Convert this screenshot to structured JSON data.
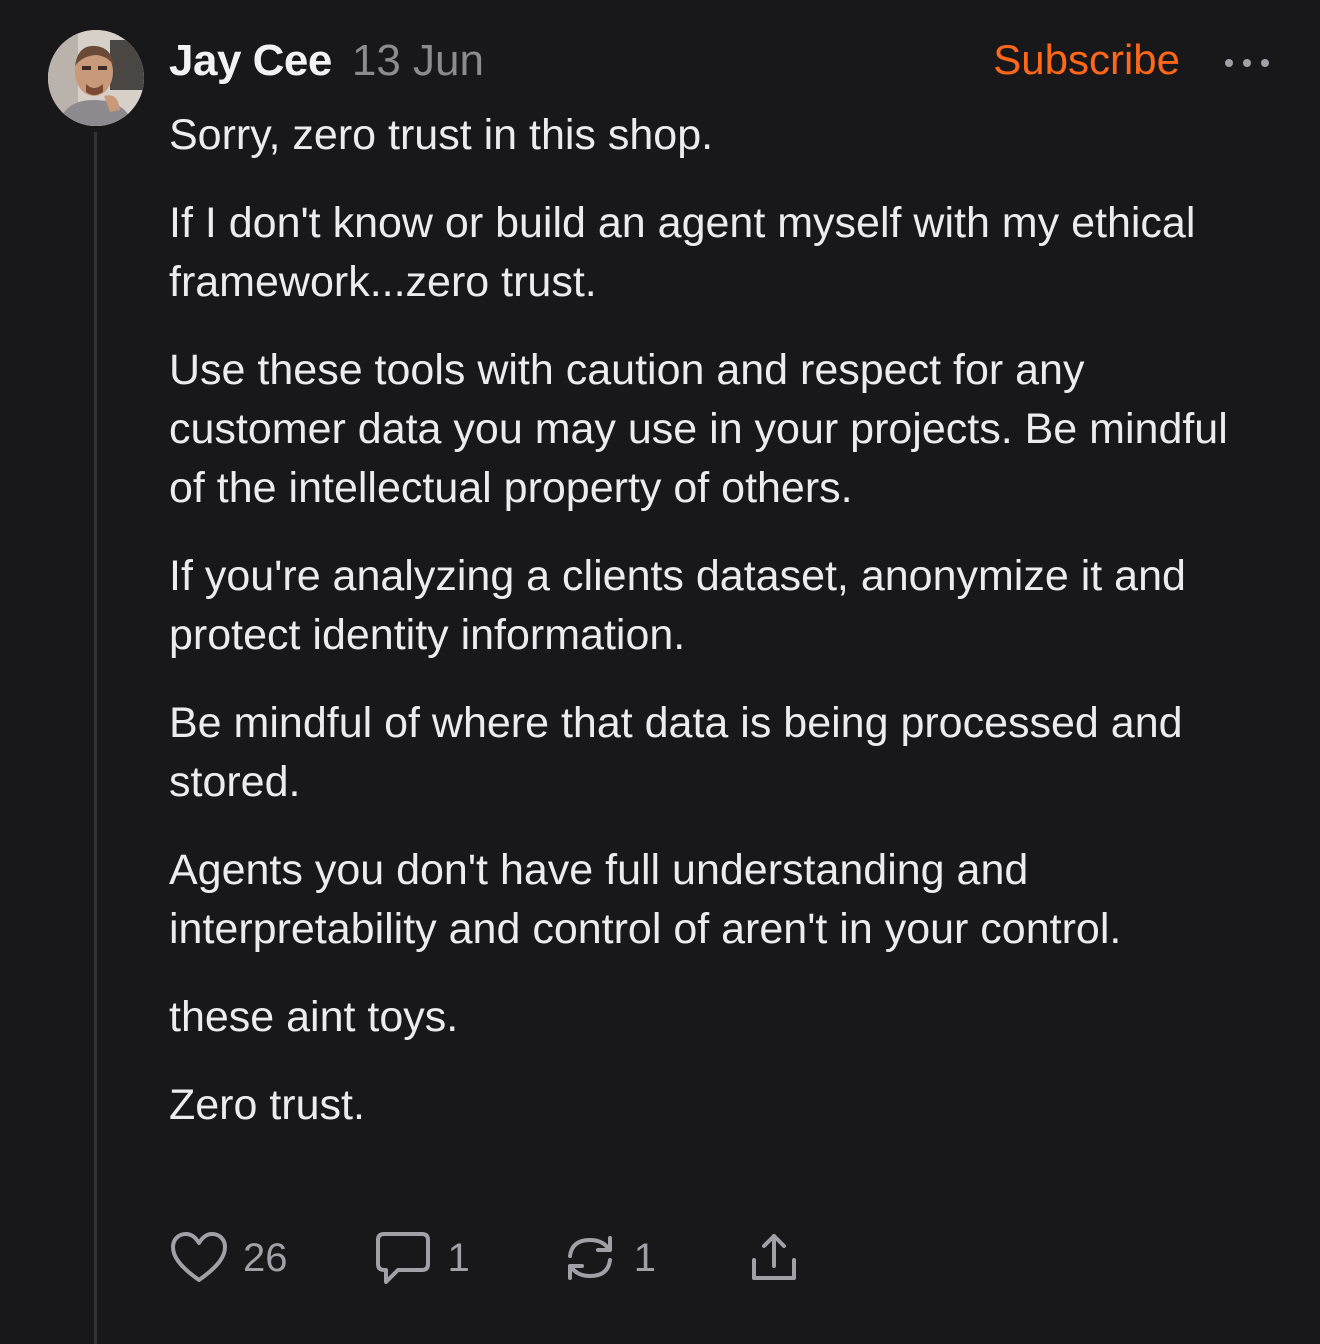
{
  "post": {
    "author": "Jay Cee",
    "date": "13 Jun",
    "subscribe_label": "Subscribe",
    "paragraphs": [
      "Sorry, zero trust in this shop.",
      "If I don't know or build an agent myself with my ethical framework...zero trust.",
      "Use these tools with caution and respect for any customer data you may use in your projects. Be mindful of the intellectual property of others.",
      "If you're analyzing a clients dataset, anonymize it and protect identity information.",
      "Be mindful of where that data is being processed and stored.",
      "Agents you don't have full understanding and interpretability and control of aren't in your control.",
      "these aint toys.",
      "Zero trust."
    ]
  },
  "actions": {
    "likes": "26",
    "comments": "1",
    "restacks": "1"
  },
  "icons": {
    "more": "more-horizontal-icon",
    "like": "heart-icon",
    "comment": "comment-bubble-icon",
    "restack": "restack-arrows-icon",
    "share": "share-upload-icon"
  },
  "colors": {
    "background": "#18181a",
    "text": "#ececee",
    "muted": "#8b8b90",
    "accent": "#ff6719"
  }
}
